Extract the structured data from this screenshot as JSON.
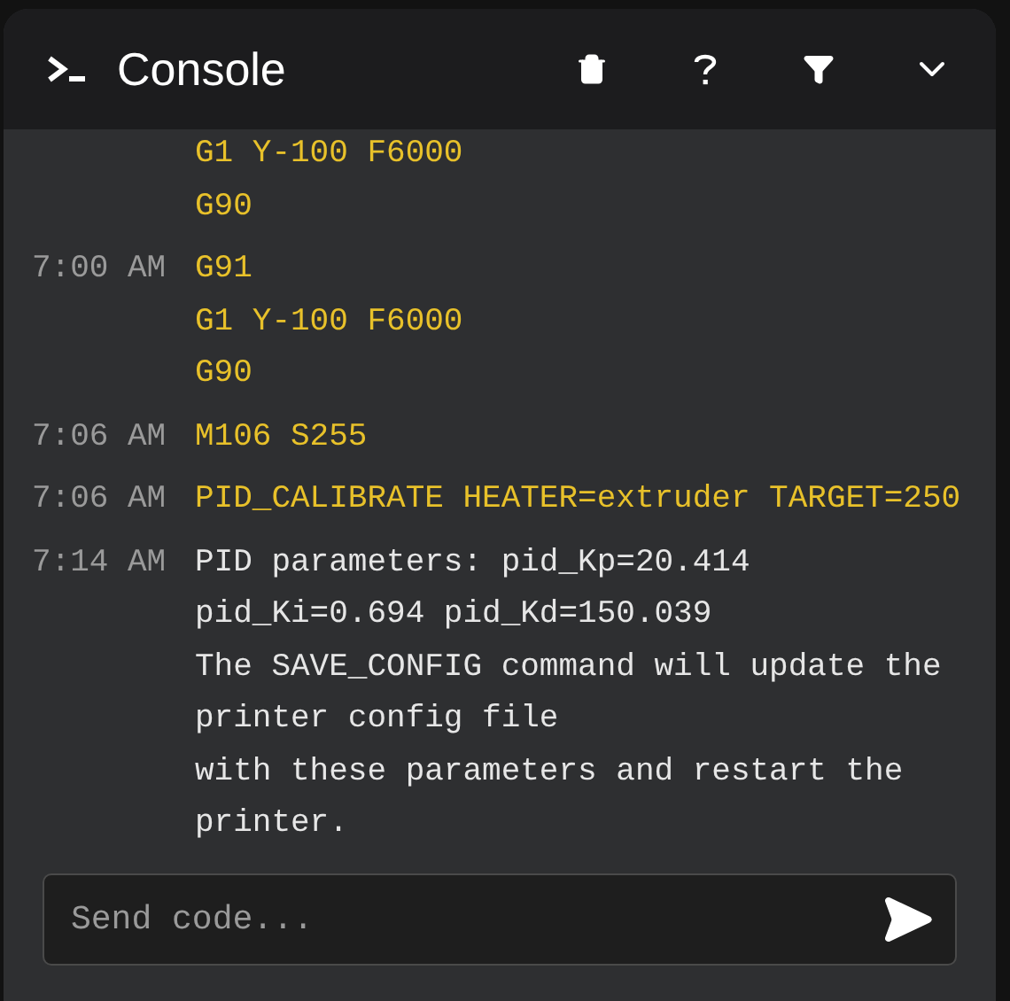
{
  "header": {
    "title": "Console"
  },
  "entries": [
    {
      "kind": "command",
      "lines": [
        "G1 Y-100 F6000",
        "G90"
      ]
    },
    {
      "kind": "command",
      "time": "7:00 AM",
      "lines": [
        "G91",
        "G1 Y-100 F6000",
        "G90"
      ]
    },
    {
      "kind": "command",
      "time": "7:06 AM",
      "lines": [
        "M106 S255"
      ]
    },
    {
      "kind": "command",
      "time": "7:06 AM",
      "lines": [
        "PID_CALIBRATE HEATER=extruder TARGET=250"
      ]
    },
    {
      "kind": "response",
      "time": "7:14 AM",
      "lines": [
        "PID parameters: pid_Kp=20.414",
        "pid_Ki=0.694 pid_Kd=150.039",
        "The SAVE_CONFIG command will update the",
        "printer config file",
        "with these parameters and restart the",
        "printer."
      ]
    }
  ],
  "input": {
    "placeholder": "Send code..."
  }
}
